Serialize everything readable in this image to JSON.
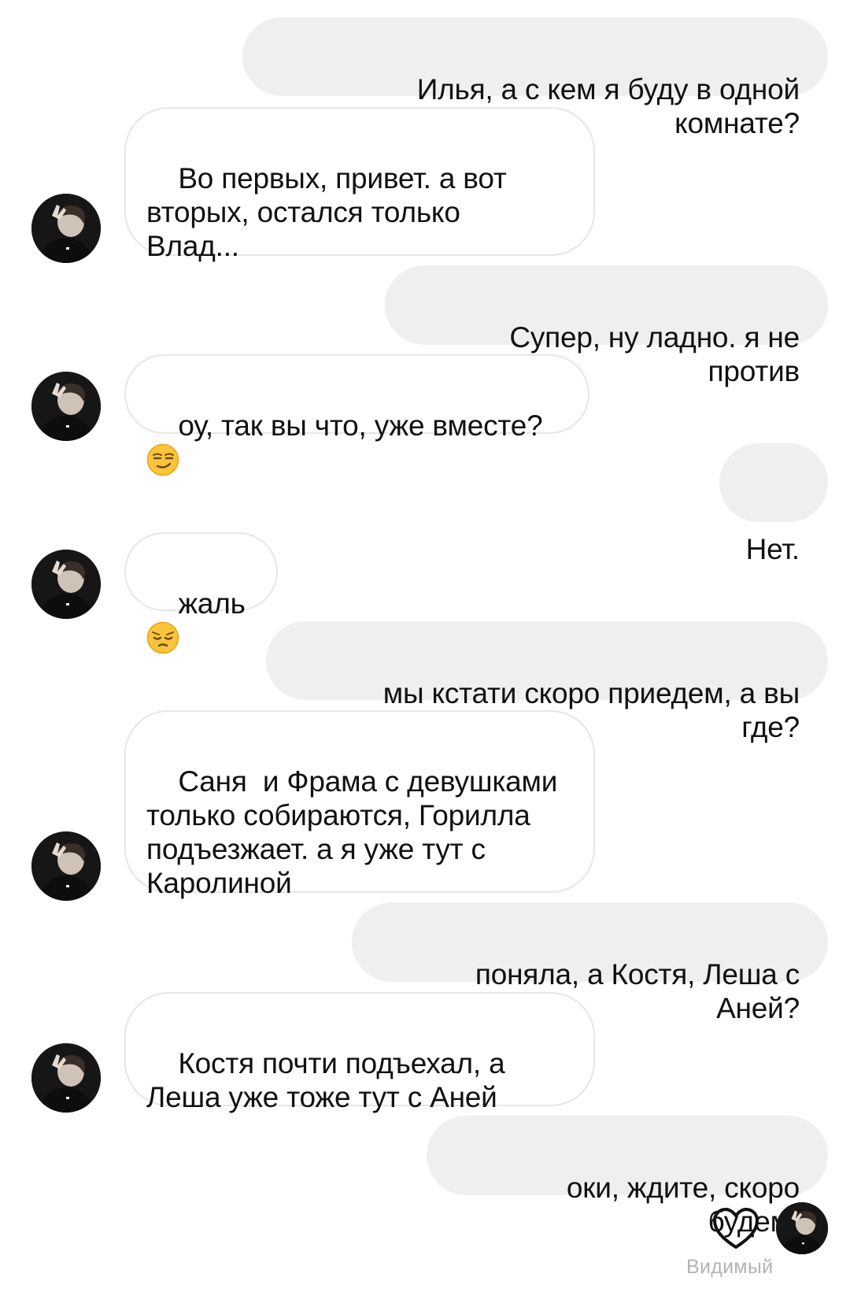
{
  "messages": [
    {
      "side": "out",
      "text": "Илья, а с кем я буду в одной комнате?"
    },
    {
      "side": "in",
      "text": "Во первых, привет. а вот\nвторых, остался только\nВлад..."
    },
    {
      "side": "out",
      "text": "Супер, ну ладно. я не против"
    },
    {
      "side": "in",
      "text": "оу, так вы что, уже вместе? ",
      "emoji": "smirking-face-icon"
    },
    {
      "side": "out",
      "text": "Нет."
    },
    {
      "side": "in",
      "text": "жаль",
      "emoji": "pensive-face-icon"
    },
    {
      "side": "out",
      "text": "мы кстати скоро приедем, а вы где?"
    },
    {
      "side": "in",
      "text": "Саня  и Фрама с девушками\nтолько собираются, Горилла\nподъезжает. а я уже тут с\nКаролиной"
    },
    {
      "side": "out",
      "text": "поняла, а Костя, Леша с Аней?"
    },
    {
      "side": "in",
      "text": "Костя почти подъехал, а\nЛеша уже тоже тут с Аней"
    },
    {
      "side": "out",
      "text": "оки, ждите, скоро будем)"
    }
  ],
  "footer": {
    "like_icon": "heart-outline-icon",
    "seen_label": "Видимый"
  },
  "colors": {
    "outgoing_bubble": "#efefef",
    "incoming_border": "#e6e6e6",
    "text": "#111111",
    "seen_text": "#b3b3b3"
  }
}
